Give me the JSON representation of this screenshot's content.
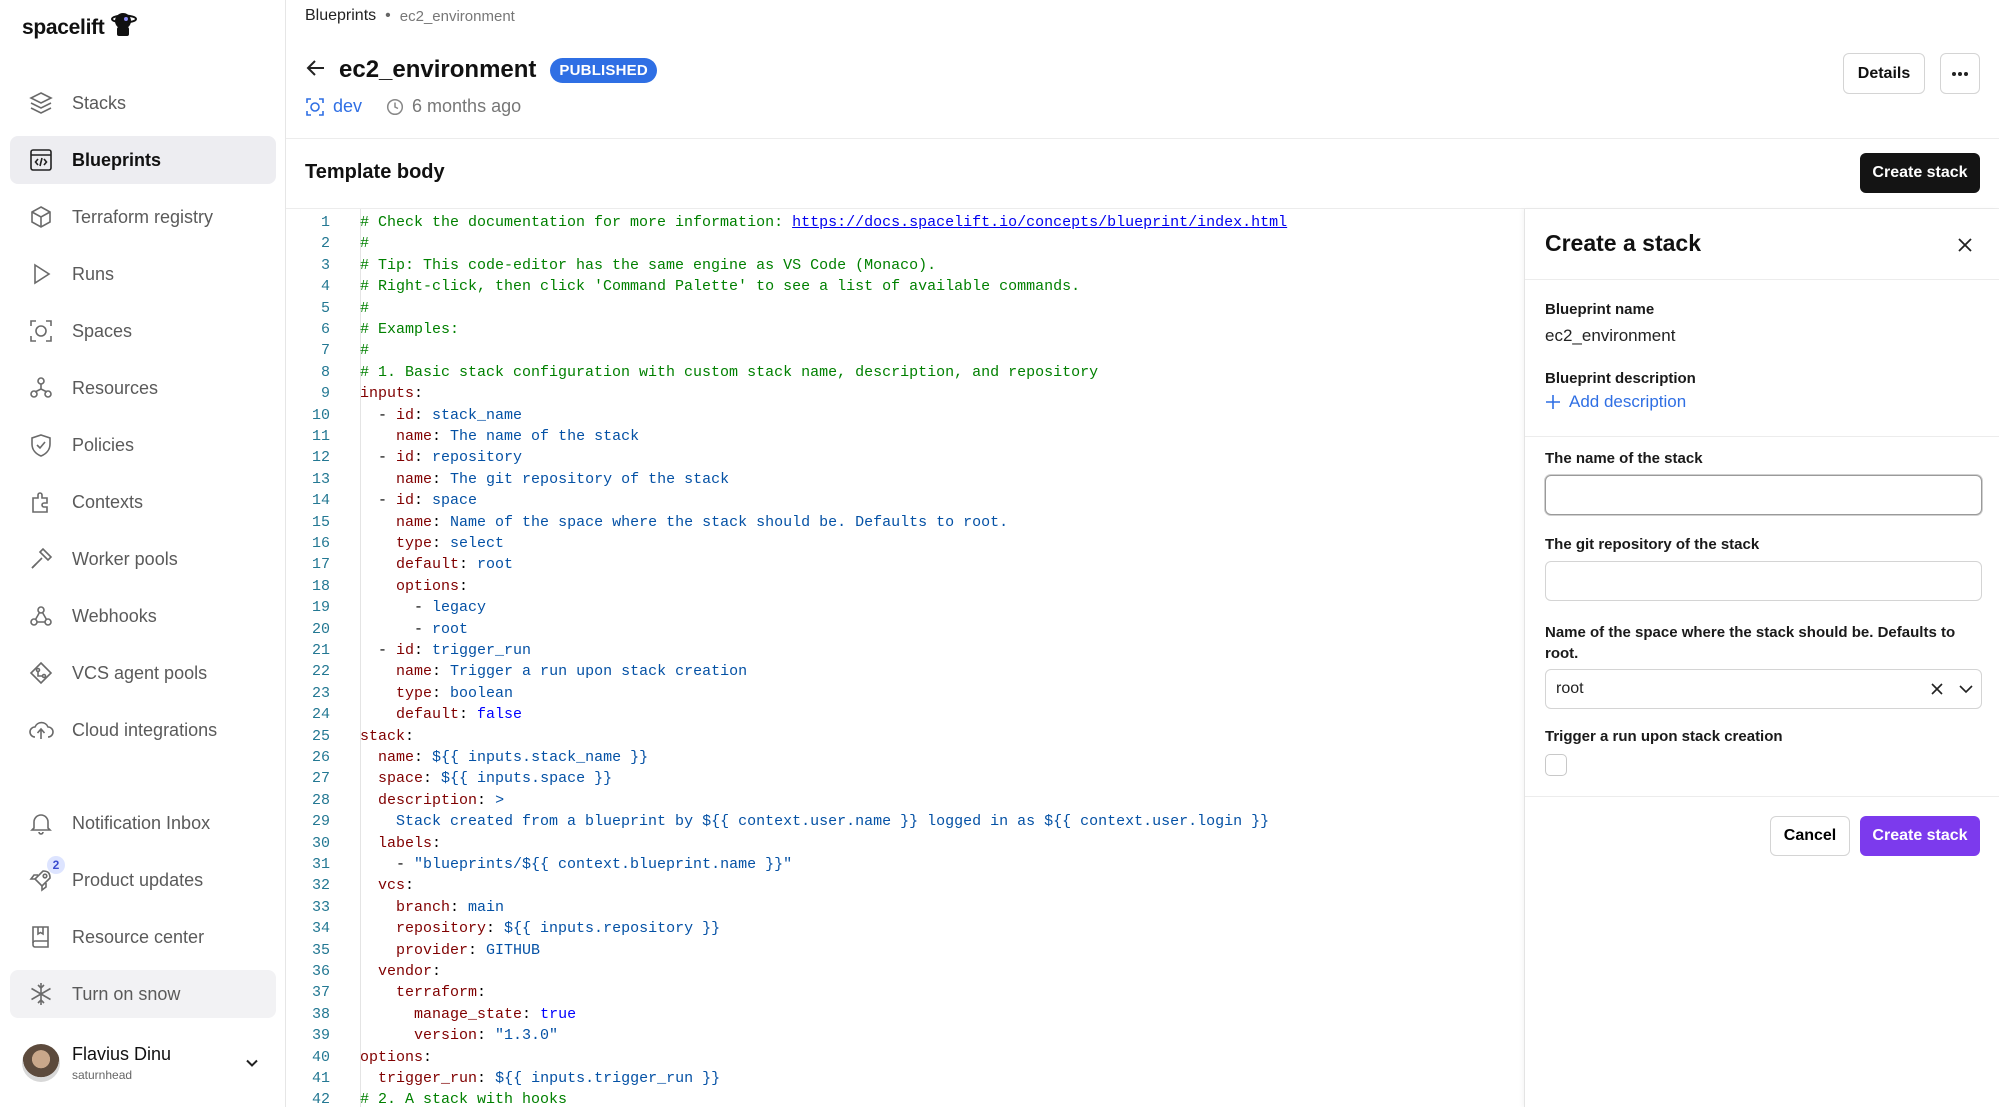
{
  "app": {
    "logo_text": "spacelift"
  },
  "sidebar": {
    "items": [
      {
        "label": "Stacks",
        "icon": "stacks-icon"
      },
      {
        "label": "Blueprints",
        "icon": "blueprints-icon",
        "active": true
      },
      {
        "label": "Terraform registry",
        "icon": "terraform-registry-icon"
      },
      {
        "label": "Runs",
        "icon": "runs-icon"
      },
      {
        "label": "Spaces",
        "icon": "spaces-icon"
      },
      {
        "label": "Resources",
        "icon": "resources-icon"
      },
      {
        "label": "Policies",
        "icon": "policies-icon"
      },
      {
        "label": "Contexts",
        "icon": "contexts-icon"
      },
      {
        "label": "Worker pools",
        "icon": "worker-pools-icon"
      },
      {
        "label": "Webhooks",
        "icon": "webhooks-icon"
      },
      {
        "label": "VCS agent pools",
        "icon": "vcs-agent-pools-icon"
      },
      {
        "label": "Cloud integrations",
        "icon": "cloud-integrations-icon"
      }
    ],
    "bottom_items": [
      {
        "label": "Notification Inbox",
        "icon": "bell-icon"
      },
      {
        "label": "Product updates",
        "icon": "rocket-icon",
        "badge": "2"
      },
      {
        "label": "Resource center",
        "icon": "book-icon"
      },
      {
        "label": "Turn on snow",
        "icon": "snowflake-icon"
      }
    ],
    "user": {
      "name": "Flavius Dinu",
      "handle": "saturnhead"
    }
  },
  "header": {
    "breadcrumb": [
      "Blueprints",
      "ec2_environment"
    ],
    "title": "ec2_environment",
    "status": "PUBLISHED",
    "space": "dev",
    "updated": "6 months ago",
    "details_label": "Details",
    "more_label": "···"
  },
  "template": {
    "section_title": "Template body",
    "create_stack_label": "Create stack",
    "lines": [
      [
        [
          "c-com",
          "# Check the documentation for more information: "
        ],
        [
          "c-link",
          "https://docs.spacelift.io/concepts/blueprint/index.html"
        ]
      ],
      [
        [
          "c-com",
          "#"
        ]
      ],
      [
        [
          "c-com",
          "# Tip: This code-editor has the same engine as VS Code (Monaco)."
        ]
      ],
      [
        [
          "c-com",
          "# Right-click, then click 'Command Palette' to see a list of available commands."
        ]
      ],
      [
        [
          "c-com",
          "#"
        ]
      ],
      [
        [
          "c-com",
          "# Examples:"
        ]
      ],
      [
        [
          "c-com",
          "#"
        ]
      ],
      [
        [
          "c-com",
          "# 1. Basic stack configuration with custom stack name, description, and repository"
        ]
      ],
      [
        [
          "c-key",
          "inputs"
        ],
        [
          "c-plain",
          ":"
        ]
      ],
      [
        [
          "c-plain",
          "  - "
        ],
        [
          "c-key",
          "id"
        ],
        [
          "c-plain",
          ": "
        ],
        [
          "c-val",
          "stack_name"
        ]
      ],
      [
        [
          "c-plain",
          "    "
        ],
        [
          "c-key",
          "name"
        ],
        [
          "c-plain",
          ": "
        ],
        [
          "c-val",
          "The name of the stack"
        ]
      ],
      [
        [
          "c-plain",
          "  - "
        ],
        [
          "c-key",
          "id"
        ],
        [
          "c-plain",
          ": "
        ],
        [
          "c-val",
          "repository"
        ]
      ],
      [
        [
          "c-plain",
          "    "
        ],
        [
          "c-key",
          "name"
        ],
        [
          "c-plain",
          ": "
        ],
        [
          "c-val",
          "The git repository of the stack"
        ]
      ],
      [
        [
          "c-plain",
          "  - "
        ],
        [
          "c-key",
          "id"
        ],
        [
          "c-plain",
          ": "
        ],
        [
          "c-val",
          "space"
        ]
      ],
      [
        [
          "c-plain",
          "    "
        ],
        [
          "c-key",
          "name"
        ],
        [
          "c-plain",
          ": "
        ],
        [
          "c-val",
          "Name of the space where the stack should be. Defaults to root."
        ]
      ],
      [
        [
          "c-plain",
          "    "
        ],
        [
          "c-key",
          "type"
        ],
        [
          "c-plain",
          ": "
        ],
        [
          "c-val",
          "select"
        ]
      ],
      [
        [
          "c-plain",
          "    "
        ],
        [
          "c-key",
          "default"
        ],
        [
          "c-plain",
          ": "
        ],
        [
          "c-val",
          "root"
        ]
      ],
      [
        [
          "c-plain",
          "    "
        ],
        [
          "c-key",
          "options"
        ],
        [
          "c-plain",
          ":"
        ]
      ],
      [
        [
          "c-plain",
          "      - "
        ],
        [
          "c-val",
          "legacy"
        ]
      ],
      [
        [
          "c-plain",
          "      - "
        ],
        [
          "c-val",
          "root"
        ]
      ],
      [
        [
          "c-plain",
          "  - "
        ],
        [
          "c-key",
          "id"
        ],
        [
          "c-plain",
          ": "
        ],
        [
          "c-val",
          "trigger_run"
        ]
      ],
      [
        [
          "c-plain",
          "    "
        ],
        [
          "c-key",
          "name"
        ],
        [
          "c-plain",
          ": "
        ],
        [
          "c-val",
          "Trigger a run upon stack creation"
        ]
      ],
      [
        [
          "c-plain",
          "    "
        ],
        [
          "c-key",
          "type"
        ],
        [
          "c-plain",
          ": "
        ],
        [
          "c-val",
          "boolean"
        ]
      ],
      [
        [
          "c-plain",
          "    "
        ],
        [
          "c-key",
          "default"
        ],
        [
          "c-plain",
          ": "
        ],
        [
          "c-kw",
          "false"
        ]
      ],
      [
        [
          "c-key",
          "stack"
        ],
        [
          "c-plain",
          ":"
        ]
      ],
      [
        [
          "c-plain",
          "  "
        ],
        [
          "c-key",
          "name"
        ],
        [
          "c-plain",
          ": "
        ],
        [
          "c-val",
          "${{ inputs.stack_name }}"
        ]
      ],
      [
        [
          "c-plain",
          "  "
        ],
        [
          "c-key",
          "space"
        ],
        [
          "c-plain",
          ": "
        ],
        [
          "c-val",
          "${{ inputs.space }}"
        ]
      ],
      [
        [
          "c-plain",
          "  "
        ],
        [
          "c-key",
          "description"
        ],
        [
          "c-plain",
          ": "
        ],
        [
          "c-val",
          ">"
        ]
      ],
      [
        [
          "c-plain",
          "    "
        ],
        [
          "c-val",
          "Stack created from a blueprint by ${{ context.user.name }} logged in as ${{ context.user.login }}"
        ]
      ],
      [
        [
          "c-plain",
          "  "
        ],
        [
          "c-key",
          "labels"
        ],
        [
          "c-plain",
          ":"
        ]
      ],
      [
        [
          "c-plain",
          "    - "
        ],
        [
          "c-val",
          "\"blueprints/${{ context.blueprint.name }}\""
        ]
      ],
      [
        [
          "c-plain",
          "  "
        ],
        [
          "c-key",
          "vcs"
        ],
        [
          "c-plain",
          ":"
        ]
      ],
      [
        [
          "c-plain",
          "    "
        ],
        [
          "c-key",
          "branch"
        ],
        [
          "c-plain",
          ": "
        ],
        [
          "c-val",
          "main"
        ]
      ],
      [
        [
          "c-plain",
          "    "
        ],
        [
          "c-key",
          "repository"
        ],
        [
          "c-plain",
          ": "
        ],
        [
          "c-val",
          "${{ inputs.repository }}"
        ]
      ],
      [
        [
          "c-plain",
          "    "
        ],
        [
          "c-key",
          "provider"
        ],
        [
          "c-plain",
          ": "
        ],
        [
          "c-val",
          "GITHUB"
        ]
      ],
      [
        [
          "c-plain",
          "  "
        ],
        [
          "c-key",
          "vendor"
        ],
        [
          "c-plain",
          ":"
        ]
      ],
      [
        [
          "c-plain",
          "    "
        ],
        [
          "c-key",
          "terraform"
        ],
        [
          "c-plain",
          ":"
        ]
      ],
      [
        [
          "c-plain",
          "      "
        ],
        [
          "c-key",
          "manage_state"
        ],
        [
          "c-plain",
          ": "
        ],
        [
          "c-kw",
          "true"
        ]
      ],
      [
        [
          "c-plain",
          "      "
        ],
        [
          "c-key",
          "version"
        ],
        [
          "c-plain",
          ": "
        ],
        [
          "c-val",
          "\"1.3.0\""
        ]
      ],
      [
        [
          "c-key",
          "options"
        ],
        [
          "c-plain",
          ":"
        ]
      ],
      [
        [
          "c-plain",
          "  "
        ],
        [
          "c-key",
          "trigger_run"
        ],
        [
          "c-plain",
          ": "
        ],
        [
          "c-val",
          "${{ inputs.trigger_run }}"
        ]
      ],
      [
        [
          "c-com",
          "# 2. A stack with hooks"
        ]
      ]
    ]
  },
  "drawer": {
    "title": "Create a stack",
    "blueprint_name_label": "Blueprint name",
    "blueprint_name_value": "ec2_environment",
    "blueprint_desc_label": "Blueprint description",
    "add_description_label": "Add description",
    "field_stack_name_label": "The name of the stack",
    "field_stack_name_value": "",
    "field_repo_label": "The git repository of the stack",
    "field_repo_value": "",
    "field_space_label": "Name of the space where the stack should be. Defaults to root.",
    "field_space_value": "root",
    "field_trigger_label": "Trigger a run upon stack creation",
    "field_trigger_checked": false,
    "cancel_label": "Cancel",
    "create_label": "Create stack"
  },
  "colors": {
    "accent_purple": "#7c3aed",
    "accent_blue": "#2f6fe4",
    "dark_button": "#141414"
  }
}
